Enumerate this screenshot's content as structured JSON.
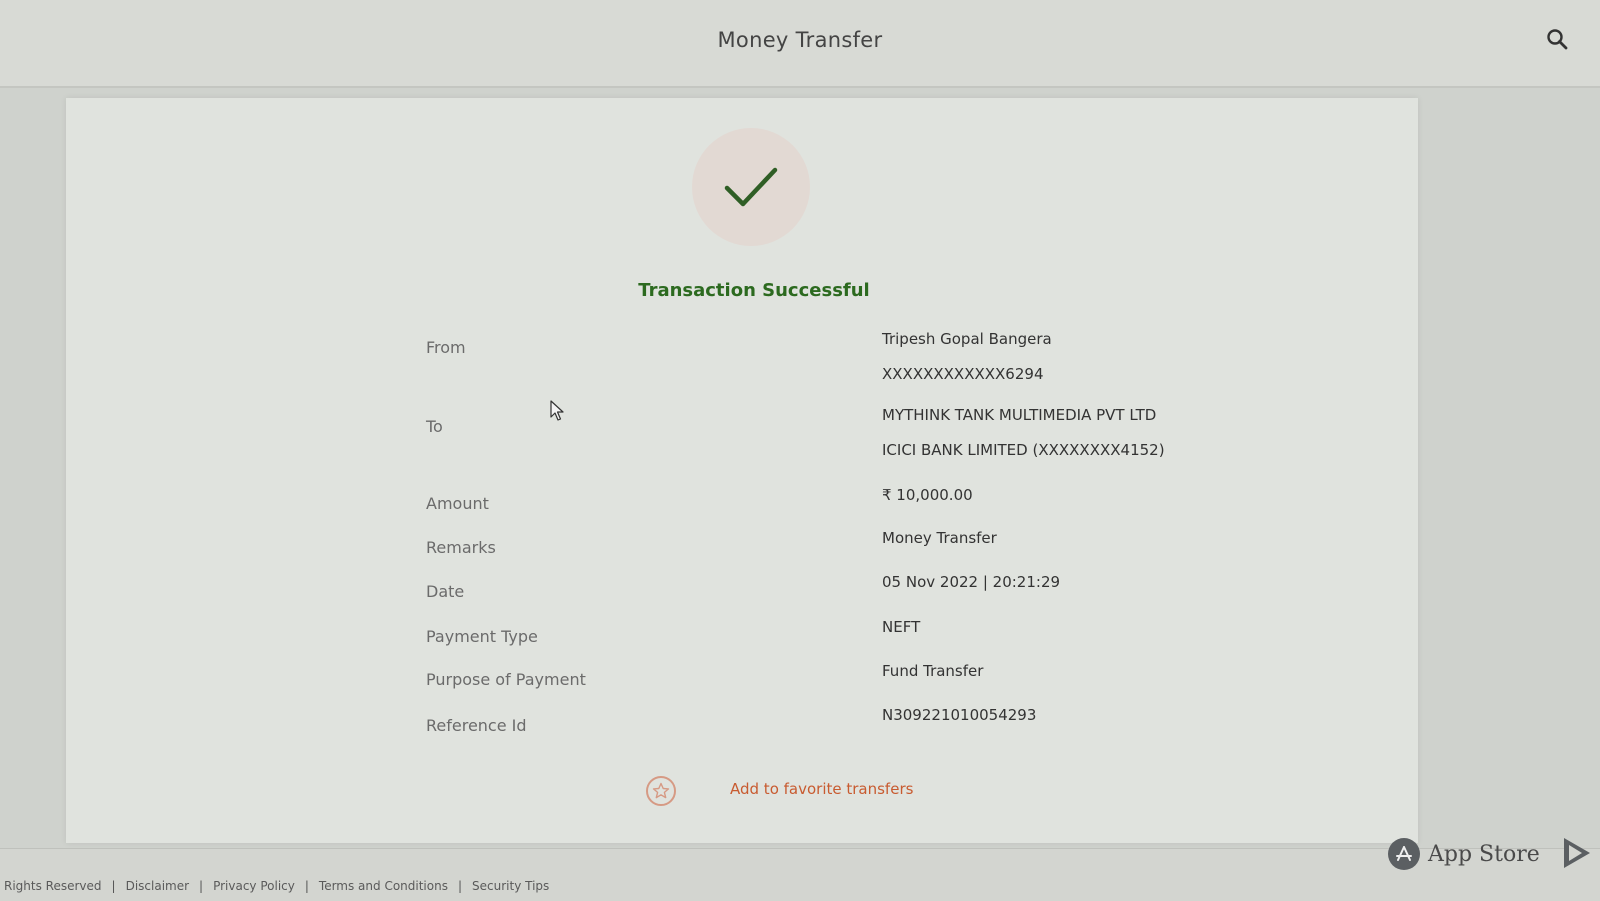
{
  "header": {
    "title": "Money Transfer",
    "search_icon": "search-icon"
  },
  "status": {
    "icon": "checkmark-icon",
    "text": "Transaction Successful",
    "color": "#2c6a1f"
  },
  "details": {
    "from": {
      "label": "From",
      "name": "Tripesh Gopal Bangera",
      "account": "XXXXXXXXXXXX6294"
    },
    "to": {
      "label": "To",
      "name": "MYTHINK TANK MULTIMEDIA PVT LTD",
      "bank": "ICICI BANK LIMITED (XXXXXXXX4152)"
    },
    "amount": {
      "label": "Amount",
      "value": "₹ 10,000.00"
    },
    "remarks": {
      "label": "Remarks",
      "value": "Money Transfer"
    },
    "date": {
      "label": "Date",
      "value": "05 Nov 2022 | 20:21:29"
    },
    "payment_type": {
      "label": "Payment Type",
      "value": "NEFT"
    },
    "purpose": {
      "label": "Purpose of Payment",
      "value": "Fund Transfer"
    },
    "reference": {
      "label": "Reference Id",
      "value": "N309221010054293"
    }
  },
  "favorite": {
    "icon": "star-icon",
    "label": "Add to favorite transfers"
  },
  "footer": {
    "links": [
      "Rights Reserved",
      "Disclaimer",
      "Privacy Policy",
      "Terms and Conditions",
      "Security Tips"
    ],
    "app_store_label": "App Store",
    "app_store_icon": "app-store-icon",
    "play_store_icon": "play-store-icon"
  },
  "colors": {
    "accent_green": "#2c6a1f",
    "link_orange": "#c85b30",
    "check_circle_bg": "#e2d9d3"
  }
}
